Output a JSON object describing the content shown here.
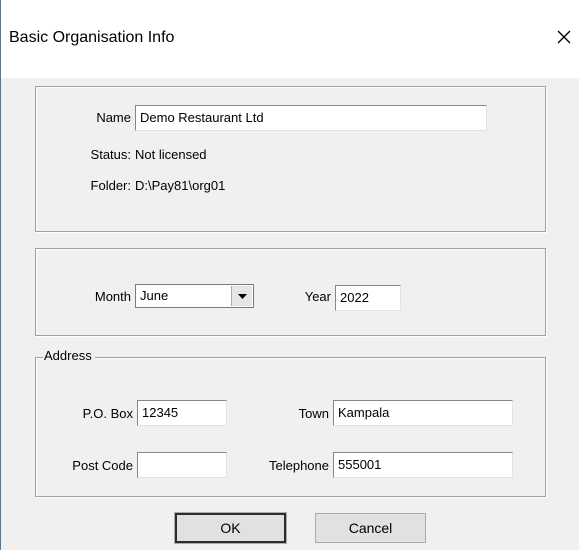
{
  "window": {
    "title": "Basic Organisation Info"
  },
  "info": {
    "name_label": "Name",
    "name_value": "Demo Restaurant Ltd",
    "status_label": "Status:",
    "status_value": "Not licensed",
    "folder_label": "Folder:",
    "folder_value": "D:\\Pay81\\org01"
  },
  "period": {
    "month_label": "Month",
    "month_value": "June",
    "year_label": "Year",
    "year_value": "2022"
  },
  "address": {
    "group_label": "Address",
    "pobox_label": "P.O. Box",
    "pobox_value": "12345",
    "town_label": "Town",
    "town_value": "Kampala",
    "postcode_label": "Post Code",
    "postcode_value": "",
    "telephone_label": "Telephone",
    "telephone_value": "555001"
  },
  "buttons": {
    "ok_label": "OK",
    "cancel_label": "Cancel"
  },
  "icons": {
    "close": "close-icon",
    "dropdown": "chevron-down-icon"
  },
  "colors": {
    "window_border": "#3c7fb1",
    "dialog_background": "#f0f0f0",
    "title_background": "#ffffff"
  }
}
